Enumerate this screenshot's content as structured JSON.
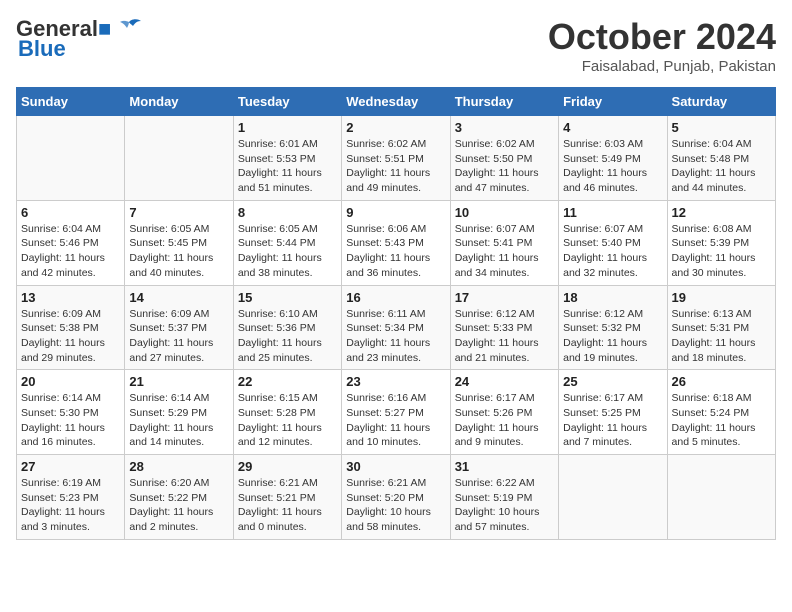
{
  "logo": {
    "part1": "General",
    "part2": "Blue"
  },
  "title": "October 2024",
  "location": "Faisalabad, Punjab, Pakistan",
  "headers": [
    "Sunday",
    "Monday",
    "Tuesday",
    "Wednesday",
    "Thursday",
    "Friday",
    "Saturday"
  ],
  "weeks": [
    [
      {
        "day": "",
        "detail": ""
      },
      {
        "day": "",
        "detail": ""
      },
      {
        "day": "1",
        "detail": "Sunrise: 6:01 AM\nSunset: 5:53 PM\nDaylight: 11 hours and 51 minutes."
      },
      {
        "day": "2",
        "detail": "Sunrise: 6:02 AM\nSunset: 5:51 PM\nDaylight: 11 hours and 49 minutes."
      },
      {
        "day": "3",
        "detail": "Sunrise: 6:02 AM\nSunset: 5:50 PM\nDaylight: 11 hours and 47 minutes."
      },
      {
        "day": "4",
        "detail": "Sunrise: 6:03 AM\nSunset: 5:49 PM\nDaylight: 11 hours and 46 minutes."
      },
      {
        "day": "5",
        "detail": "Sunrise: 6:04 AM\nSunset: 5:48 PM\nDaylight: 11 hours and 44 minutes."
      }
    ],
    [
      {
        "day": "6",
        "detail": "Sunrise: 6:04 AM\nSunset: 5:46 PM\nDaylight: 11 hours and 42 minutes."
      },
      {
        "day": "7",
        "detail": "Sunrise: 6:05 AM\nSunset: 5:45 PM\nDaylight: 11 hours and 40 minutes."
      },
      {
        "day": "8",
        "detail": "Sunrise: 6:05 AM\nSunset: 5:44 PM\nDaylight: 11 hours and 38 minutes."
      },
      {
        "day": "9",
        "detail": "Sunrise: 6:06 AM\nSunset: 5:43 PM\nDaylight: 11 hours and 36 minutes."
      },
      {
        "day": "10",
        "detail": "Sunrise: 6:07 AM\nSunset: 5:41 PM\nDaylight: 11 hours and 34 minutes."
      },
      {
        "day": "11",
        "detail": "Sunrise: 6:07 AM\nSunset: 5:40 PM\nDaylight: 11 hours and 32 minutes."
      },
      {
        "day": "12",
        "detail": "Sunrise: 6:08 AM\nSunset: 5:39 PM\nDaylight: 11 hours and 30 minutes."
      }
    ],
    [
      {
        "day": "13",
        "detail": "Sunrise: 6:09 AM\nSunset: 5:38 PM\nDaylight: 11 hours and 29 minutes."
      },
      {
        "day": "14",
        "detail": "Sunrise: 6:09 AM\nSunset: 5:37 PM\nDaylight: 11 hours and 27 minutes."
      },
      {
        "day": "15",
        "detail": "Sunrise: 6:10 AM\nSunset: 5:36 PM\nDaylight: 11 hours and 25 minutes."
      },
      {
        "day": "16",
        "detail": "Sunrise: 6:11 AM\nSunset: 5:34 PM\nDaylight: 11 hours and 23 minutes."
      },
      {
        "day": "17",
        "detail": "Sunrise: 6:12 AM\nSunset: 5:33 PM\nDaylight: 11 hours and 21 minutes."
      },
      {
        "day": "18",
        "detail": "Sunrise: 6:12 AM\nSunset: 5:32 PM\nDaylight: 11 hours and 19 minutes."
      },
      {
        "day": "19",
        "detail": "Sunrise: 6:13 AM\nSunset: 5:31 PM\nDaylight: 11 hours and 18 minutes."
      }
    ],
    [
      {
        "day": "20",
        "detail": "Sunrise: 6:14 AM\nSunset: 5:30 PM\nDaylight: 11 hours and 16 minutes."
      },
      {
        "day": "21",
        "detail": "Sunrise: 6:14 AM\nSunset: 5:29 PM\nDaylight: 11 hours and 14 minutes."
      },
      {
        "day": "22",
        "detail": "Sunrise: 6:15 AM\nSunset: 5:28 PM\nDaylight: 11 hours and 12 minutes."
      },
      {
        "day": "23",
        "detail": "Sunrise: 6:16 AM\nSunset: 5:27 PM\nDaylight: 11 hours and 10 minutes."
      },
      {
        "day": "24",
        "detail": "Sunrise: 6:17 AM\nSunset: 5:26 PM\nDaylight: 11 hours and 9 minutes."
      },
      {
        "day": "25",
        "detail": "Sunrise: 6:17 AM\nSunset: 5:25 PM\nDaylight: 11 hours and 7 minutes."
      },
      {
        "day": "26",
        "detail": "Sunrise: 6:18 AM\nSunset: 5:24 PM\nDaylight: 11 hours and 5 minutes."
      }
    ],
    [
      {
        "day": "27",
        "detail": "Sunrise: 6:19 AM\nSunset: 5:23 PM\nDaylight: 11 hours and 3 minutes."
      },
      {
        "day": "28",
        "detail": "Sunrise: 6:20 AM\nSunset: 5:22 PM\nDaylight: 11 hours and 2 minutes."
      },
      {
        "day": "29",
        "detail": "Sunrise: 6:21 AM\nSunset: 5:21 PM\nDaylight: 11 hours and 0 minutes."
      },
      {
        "day": "30",
        "detail": "Sunrise: 6:21 AM\nSunset: 5:20 PM\nDaylight: 10 hours and 58 minutes."
      },
      {
        "day": "31",
        "detail": "Sunrise: 6:22 AM\nSunset: 5:19 PM\nDaylight: 10 hours and 57 minutes."
      },
      {
        "day": "",
        "detail": ""
      },
      {
        "day": "",
        "detail": ""
      }
    ]
  ]
}
